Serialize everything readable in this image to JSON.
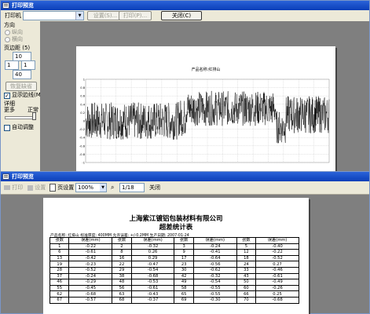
{
  "top_window": {
    "title": "打印预览",
    "printer_label": "打印机",
    "setup_label": "设置(S)...",
    "print_label": "打印(P)...",
    "close_label": "关闭(C)",
    "orientation_label": "方向",
    "portrait_label": "纵向",
    "landscape_label": "横向",
    "page_margin_label": "页边距 (5)",
    "margin_top": "10",
    "margin_mid1": "1",
    "margin_mid2": "1",
    "margin_bottom": "40",
    "restore_label": "恢复缺省(D)",
    "show_margin_label": "显示边线(M)",
    "detail_label": "详细",
    "more_label": "更多",
    "normal_label": "正常",
    "auto_adjust_label": "自动调整",
    "show_margin_checked": true
  },
  "chart": {
    "title1": "产品名称:红排山",
    "title2": "直长度2408.6M 标准厚度400MM 允许误差+/-0.2MM 生产日期:2007-01-24",
    "y_ticks": [
      "1",
      "0.8",
      "0.6",
      "0.4",
      "0.2",
      "0",
      "-0.2",
      "-0.4",
      "-0.6",
      "-0.8",
      "-1"
    ]
  },
  "chart_data": {
    "type": "line",
    "title": "产品名称:红排山",
    "subtitle": "直长度2408.6M 标准厚度400MM 允许误差+/-0.2MM 生产日期:2007-01-24",
    "ylim": [
      -1,
      1
    ],
    "grid": true,
    "series": [
      {
        "segments": [
          {
            "x_from": 0,
            "x_to": 0.38,
            "center": 0.0,
            "amplitude": 0.45
          },
          {
            "x_from": 0.38,
            "x_to": 0.41,
            "center": 0.08,
            "amplitude": 0.45
          },
          {
            "x_from": 0.41,
            "x_to": 0.78,
            "center": 0.3,
            "amplitude": 0.42
          },
          {
            "x_from": 0.78,
            "x_to": 0.82,
            "center": -0.15,
            "amplitude": 0.4
          },
          {
            "x_from": 0.82,
            "x_to": 1.0,
            "center": 0.15,
            "amplitude": 0.45
          }
        ]
      }
    ]
  },
  "bottom_window": {
    "title": "打印预览",
    "toolbar": {
      "print_label": "打印",
      "setup_label": "设置",
      "pages_label": "页设置",
      "zoom_value": "100%",
      "page_value": "1/18",
      "close_label": "关闭"
    }
  },
  "report": {
    "company": "上海紫江镀铝包装材料有限公司",
    "subtitle": "超差统计表",
    "info": "产品名称: 红排山  标准厚度: 400MM  允许误差: +/-0.2MM  生产日期: 2007-01-24",
    "headers": [
      "张数",
      "误差(mm)",
      "张数",
      "误差(mm)",
      "张数",
      "误差(mm)",
      "张数",
      "误差(mm)"
    ],
    "rows": [
      [
        "1",
        "-0.22",
        "2",
        "-0.32",
        "3",
        "-0.24",
        "5",
        "-0.40"
      ],
      [
        "6",
        "-0.61",
        "8",
        "0.26",
        "9",
        "-0.41",
        "12",
        "-0.22"
      ],
      [
        "13",
        "-0.42",
        "16",
        "0.29",
        "17",
        "-0.64",
        "18",
        "-0.52"
      ],
      [
        "19",
        "-0.23",
        "22",
        "-0.47",
        "23",
        "-0.56",
        "24",
        "0.27"
      ],
      [
        "28",
        "-0.52",
        "29",
        "-0.54",
        "30",
        "-0.62",
        "33",
        "-0.46"
      ],
      [
        "37",
        "-0.24",
        "38",
        "-0.68",
        "42",
        "-0.32",
        "43",
        "-0.61"
      ],
      [
        "46",
        "-0.29",
        "48",
        "-0.53",
        "49",
        "-0.54",
        "50",
        "-0.49"
      ],
      [
        "55",
        "-0.45",
        "56",
        "-0.61",
        "58",
        "-0.55",
        "60",
        "-0.26"
      ],
      [
        "62",
        "-0.68",
        "63",
        "-0.43",
        "65",
        "-0.55",
        "66",
        "0.25"
      ],
      [
        "67",
        "-0.57",
        "68",
        "-0.37",
        "69",
        "-0.30",
        "70",
        "-0.68"
      ]
    ]
  }
}
